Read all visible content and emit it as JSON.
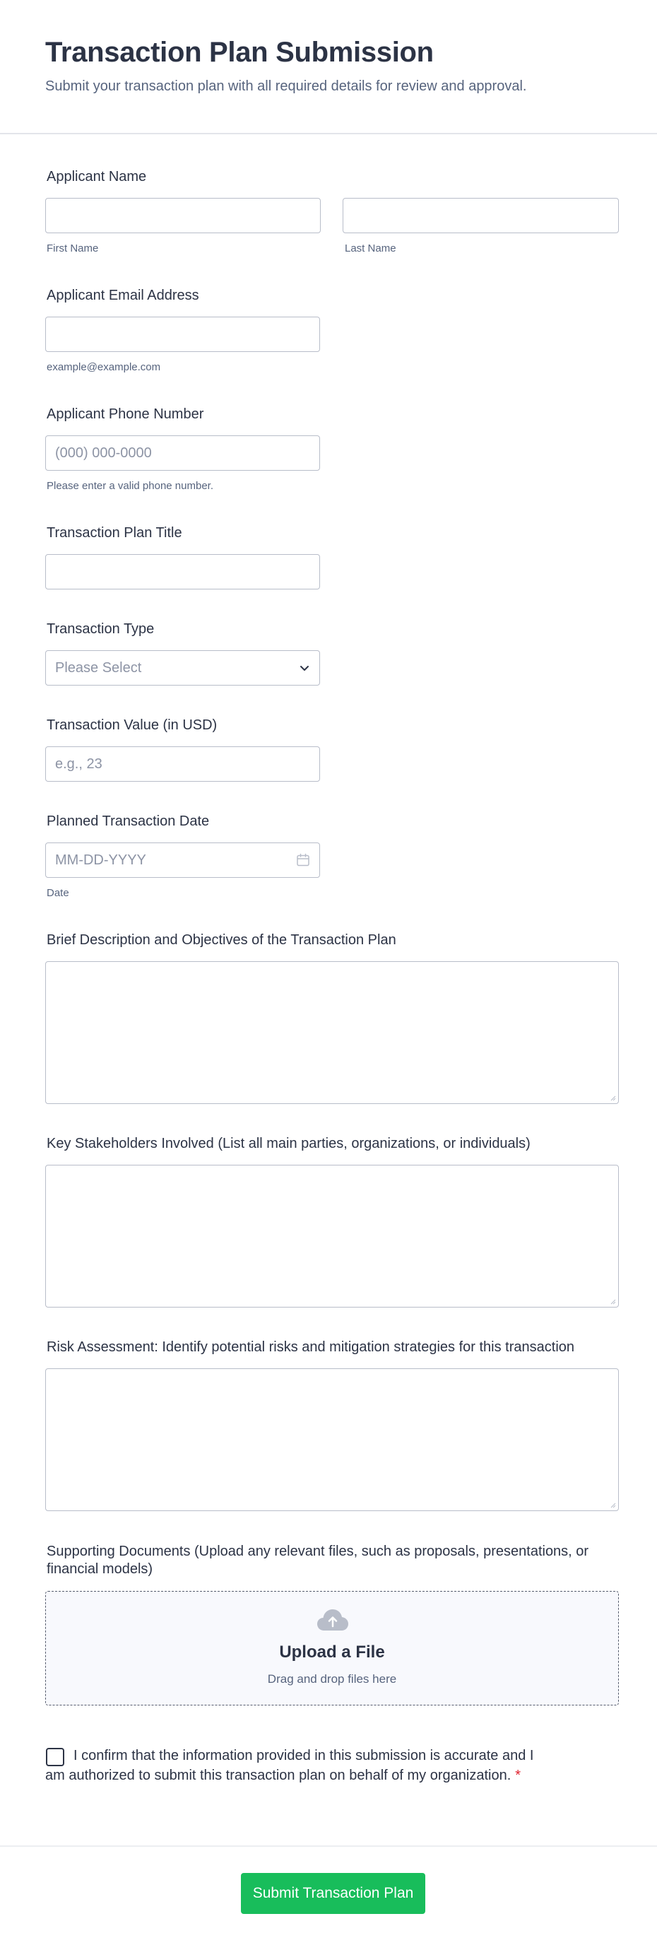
{
  "form": {
    "title": "Transaction Plan Submission",
    "subtitle": "Submit your transaction plan with all required details for review and approval."
  },
  "fields": {
    "applicant_name": {
      "label": "Applicant Name",
      "first_value": "",
      "first_sublabel": "First Name",
      "last_value": "",
      "last_sublabel": "Last Name"
    },
    "email": {
      "label": "Applicant Email Address",
      "value": "",
      "sublabel": "example@example.com"
    },
    "phone": {
      "label": "Applicant Phone Number",
      "placeholder": "(000) 000-0000",
      "sublabel": "Please enter a valid phone number."
    },
    "plan_title": {
      "label": "Transaction Plan Title",
      "value": ""
    },
    "transaction_type": {
      "label": "Transaction Type",
      "selected": "Please Select",
      "icon": "chevron-down-icon"
    },
    "transaction_value": {
      "label": "Transaction Value (in USD)",
      "placeholder": "e.g., 23"
    },
    "planned_date": {
      "label": "Planned Transaction Date",
      "placeholder": "MM-DD-YYYY",
      "sublabel": "Date",
      "icon": "calendar-icon"
    },
    "description": {
      "label": "Brief Description and Objectives of the Transaction Plan",
      "value": ""
    },
    "stakeholders": {
      "label": "Key Stakeholders Involved (List all main parties, organizations, or individuals)",
      "value": ""
    },
    "risk": {
      "label": "Risk Assessment: Identify potential risks and mitigation strategies for this transaction",
      "value": ""
    },
    "documents": {
      "label": "Supporting Documents (Upload any relevant files, such as proposals, presentations, or financial models)",
      "upload_title": "Upload a File",
      "upload_hint": "Drag and drop files here",
      "icon": "cloud-upload-icon"
    },
    "consent": {
      "text": "I confirm that the information provided in this submission is accurate and I am authorized to submit this transaction plan on behalf of my organization.",
      "required_mark": "*",
      "checked": false
    }
  },
  "submit": {
    "label": "Submit Transaction Plan"
  },
  "colors": {
    "accent": "#18bd5b",
    "required": "#e0212d",
    "text": "#2c3345",
    "muted": "#57647e",
    "border": "#b8bdc9"
  }
}
